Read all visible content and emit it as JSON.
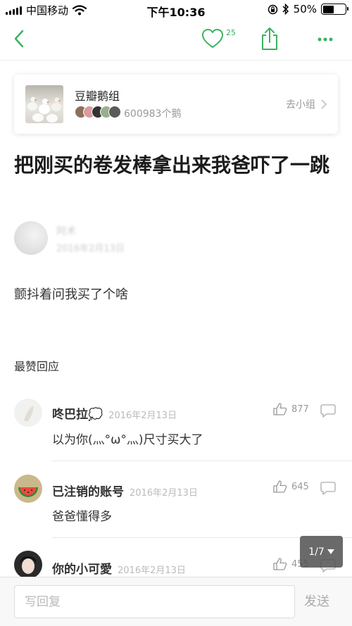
{
  "status_bar": {
    "carrier": "中国移动",
    "time": "下午10:36",
    "battery_percent": "50%",
    "battery_level": 0.5
  },
  "nav": {
    "like_count": "25",
    "accent_color": "#3ab25f"
  },
  "group": {
    "name": "豆瓣鹅组",
    "member_count": "600983个鹅",
    "go_label": "去小组"
  },
  "post": {
    "title": "把刚买的卷发棒拿出来我爸吓了一跳",
    "author_name": "阿术",
    "date": "2016年2月13日",
    "body": "颤抖着问我买了个啥"
  },
  "comments_section": {
    "title": "最赞回应",
    "items": [
      {
        "name": "咚巴拉💭",
        "date": "2016年2月13日",
        "text": "以为你(灬°ω°灬)尺寸买大了",
        "likes": "877"
      },
      {
        "name": "已注销的账号",
        "date": "2016年2月13日",
        "text": "爸爸懂得多",
        "likes": "645"
      },
      {
        "name": "你的小可愛",
        "date": "2016年2月13日",
        "text": "",
        "likes": "455"
      }
    ]
  },
  "pager": {
    "label": "1/7"
  },
  "reply_bar": {
    "placeholder": "写回复",
    "send_label": "发送"
  }
}
